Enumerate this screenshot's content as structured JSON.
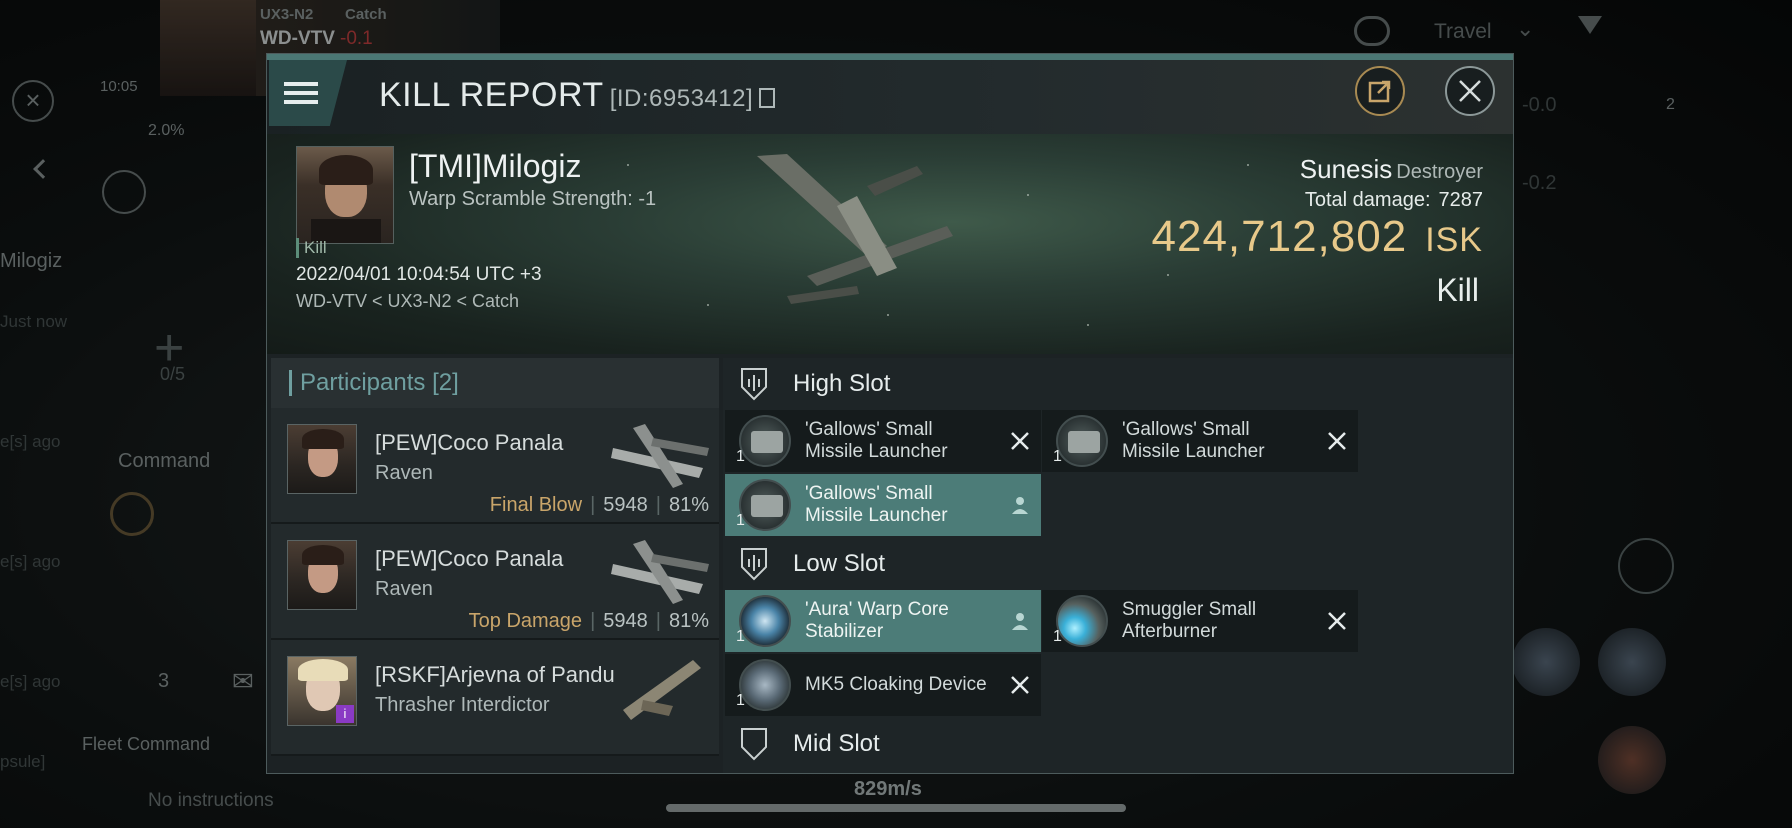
{
  "background": {
    "system_small": "UX3-N2",
    "route_small": "Catch",
    "system_main": "WD-VTV",
    "security": "-0.1",
    "time": "10:05",
    "percent": "2.0%",
    "travel_label": "Travel",
    "side_name": "Milogiz",
    "just_now": "Just now",
    "ago1": "e[s] ago",
    "ago2": "e[s] ago",
    "ago3": "e[s] ago",
    "fleet_count": "0/5",
    "command_label": "Command",
    "member_count": "3",
    "fleet_command": "Fleet Command",
    "no_instructions": "No instructions",
    "speed": "829m/s",
    "val1": "-0.0",
    "val2": "-0.2",
    "badge": "2",
    "capsule": "psule]"
  },
  "modal": {
    "title": "KILL REPORT",
    "report_id": "[ID:6953412]"
  },
  "victim": {
    "name": "[TMI]Milogiz",
    "warp": "Warp Scramble Strength: -1",
    "tag": "Kill",
    "datetime": "2022/04/01 10:04:54 UTC +3",
    "location": "WD-VTV < UX3-N2 < Catch",
    "ship": "Sunesis",
    "ship_class": "Destroyer",
    "total_damage_label": "Total damage:",
    "total_damage": "7287",
    "isk_value": "424,712,802",
    "isk_unit": "ISK",
    "result": "Kill"
  },
  "participants": {
    "label": "Participants",
    "count": "[2]",
    "rows": [
      {
        "name": "[PEW]Coco Panala",
        "ship": "Raven",
        "role": "Final Blow",
        "damage": "5948",
        "percent": "81%"
      },
      {
        "name": "[PEW]Coco Panala",
        "ship": "Raven",
        "role": "Top Damage",
        "damage": "5948",
        "percent": "81%"
      },
      {
        "name": "[RSKF]Arjevna of Pandu",
        "ship": "Thrasher Interdictor",
        "role": "",
        "damage": "",
        "percent": ""
      }
    ]
  },
  "fitting": {
    "high_slot": {
      "title": "High Slot",
      "items": [
        {
          "name": "'Gallows' Small Missile Launcher",
          "qty": "1",
          "state": "destroyed"
        },
        {
          "name": "'Gallows' Small Missile Launcher",
          "qty": "1",
          "state": "destroyed"
        },
        {
          "name": "'Gallows' Small Missile Launcher",
          "qty": "1",
          "state": "dropped"
        }
      ]
    },
    "low_slot": {
      "title": "Low Slot",
      "items": [
        {
          "name": "'Aura' Warp Core Stabilizer",
          "qty": "1",
          "state": "dropped"
        },
        {
          "name": "Smuggler Small Afterburner",
          "qty": "1",
          "state": "destroyed"
        },
        {
          "name": "MK5 Cloaking Device",
          "qty": "1",
          "state": "destroyed"
        }
      ]
    },
    "next_slot_partial": "Mid Slot"
  },
  "colors": {
    "accent": "#4c7c78",
    "isk": "#e8c98a",
    "role": "#c9a56a"
  }
}
